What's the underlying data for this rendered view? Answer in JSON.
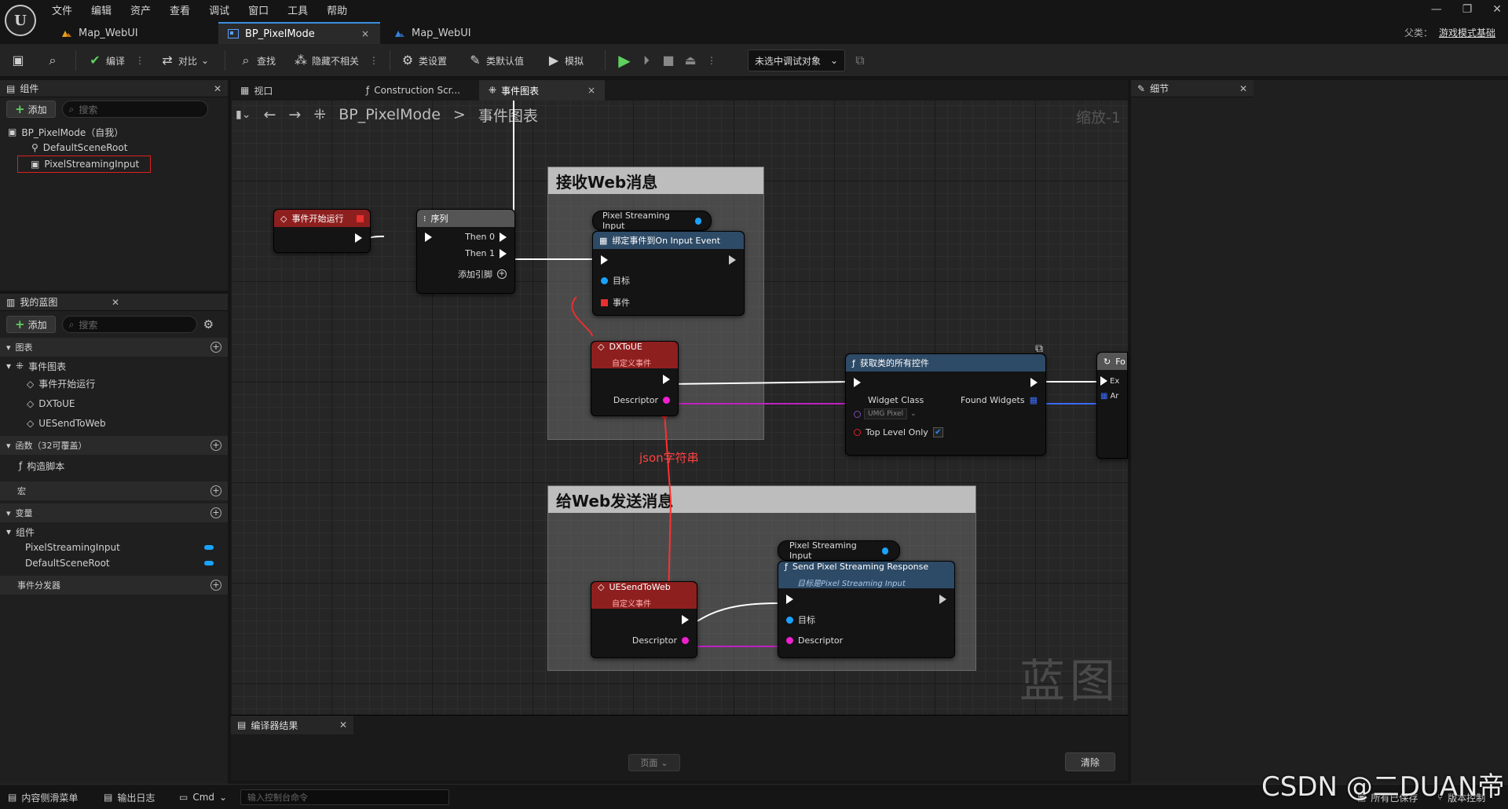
{
  "app": {
    "logo": "U"
  },
  "menu": [
    "文件",
    "编辑",
    "资产",
    "查看",
    "调试",
    "窗口",
    "工具",
    "帮助"
  ],
  "window_controls": [
    "—",
    "❐",
    "✕"
  ],
  "doc_tabs": [
    {
      "label": "Map_WebUI",
      "active": false
    },
    {
      "label": "BP_PixelMode",
      "active": true,
      "close": "×"
    },
    {
      "label": "Map_WebUI",
      "active": false
    }
  ],
  "parent": {
    "label": "父类：",
    "value": "游戏模式基础"
  },
  "toolbar": {
    "compile": "编译",
    "diff": "对比",
    "find": "查找",
    "hide_unrelated": "隐藏不相关",
    "class_settings": "类设置",
    "class_defaults": "类默认值",
    "simulate": "模拟",
    "debug_target": "未选中调试对象"
  },
  "components_panel": {
    "title": "组件",
    "add": "添加",
    "search_placeholder": "搜索",
    "items": [
      "BP_PixelMode（自我）",
      "DefaultSceneRoot",
      "PixelStreamingInput"
    ]
  },
  "my_blueprint": {
    "title": "我的蓝图",
    "add": "添加",
    "search_placeholder": "搜索",
    "graphs": "图表",
    "event_graph": "事件图表",
    "events": [
      "事件开始运行",
      "DXToUE",
      "UESendToWeb"
    ],
    "functions": "函数（32可覆盖）",
    "construction_script": "构造脚本",
    "macros": "宏",
    "variables": "变量",
    "components": "组件",
    "component_vars": [
      "PixelStreamingInput",
      "DefaultSceneRoot"
    ],
    "dispatchers": "事件分发器"
  },
  "graph_tabs": [
    {
      "label": "视口",
      "active": false
    },
    {
      "label": "Construction Scr...",
      "active": false
    },
    {
      "label": "事件图表",
      "active": true,
      "close": "×"
    }
  ],
  "breadcrumb": {
    "bp": "BP_PixelMode",
    "sep": ">",
    "graph": "事件图表"
  },
  "zoom": "缩放-1",
  "watermark": "蓝图",
  "comments": [
    {
      "title": "接收Web消息"
    },
    {
      "title": "给Web发送消息"
    }
  ],
  "nodes": {
    "begin_play": {
      "title": "事件开始运行"
    },
    "sequence": {
      "title": "序列",
      "then0": "Then 0",
      "then1": "Then 1",
      "add_pin": "添加引脚"
    },
    "psi1": {
      "title": "Pixel Streaming Input"
    },
    "bind_event": {
      "title": "绑定事件到On Input Event",
      "target": "目标",
      "event": "事件"
    },
    "dxtoue": {
      "title": "DXToUE",
      "subtitle": "自定义事件",
      "descriptor": "Descriptor"
    },
    "get_widgets": {
      "title": "获取类的所有控件",
      "widget_class": "Widget Class",
      "found": "Found Widgets",
      "class_value": "UMG Pixel",
      "top_level": "Top Level Only"
    },
    "partial": {
      "title": "Fo",
      "exec": "Ex",
      "arr": "Ar"
    },
    "uesend": {
      "title": "UESendToWeb",
      "subtitle": "自定义事件",
      "descriptor": "Descriptor"
    },
    "psi2": {
      "title": "Pixel Streaming Input"
    },
    "send_resp": {
      "title": "Send Pixel Streaming Response",
      "subtitle": "目标是Pixel Streaming Input",
      "target": "目标",
      "descriptor": "Descriptor"
    }
  },
  "annotation": "json字符串",
  "details_panel": {
    "title": "细节"
  },
  "compiler": {
    "title": "编译器结果",
    "page": "页面",
    "clear": "清除"
  },
  "statusbar": {
    "content_drawer": "内容侧滑菜单",
    "output_log": "输出日志",
    "cmd": "Cmd",
    "cmd_placeholder": "输入控制台命令",
    "saved": "所有已保存",
    "version": "版本控制"
  },
  "csdn": "CSDN @二DUAN帝",
  "colors": {
    "accent": "#3a8fe0",
    "event_red": "#8e1f1f",
    "func_blue": "#2d4a66",
    "pin_blue": "#1aa3ff",
    "pin_pink": "#f020d0"
  }
}
